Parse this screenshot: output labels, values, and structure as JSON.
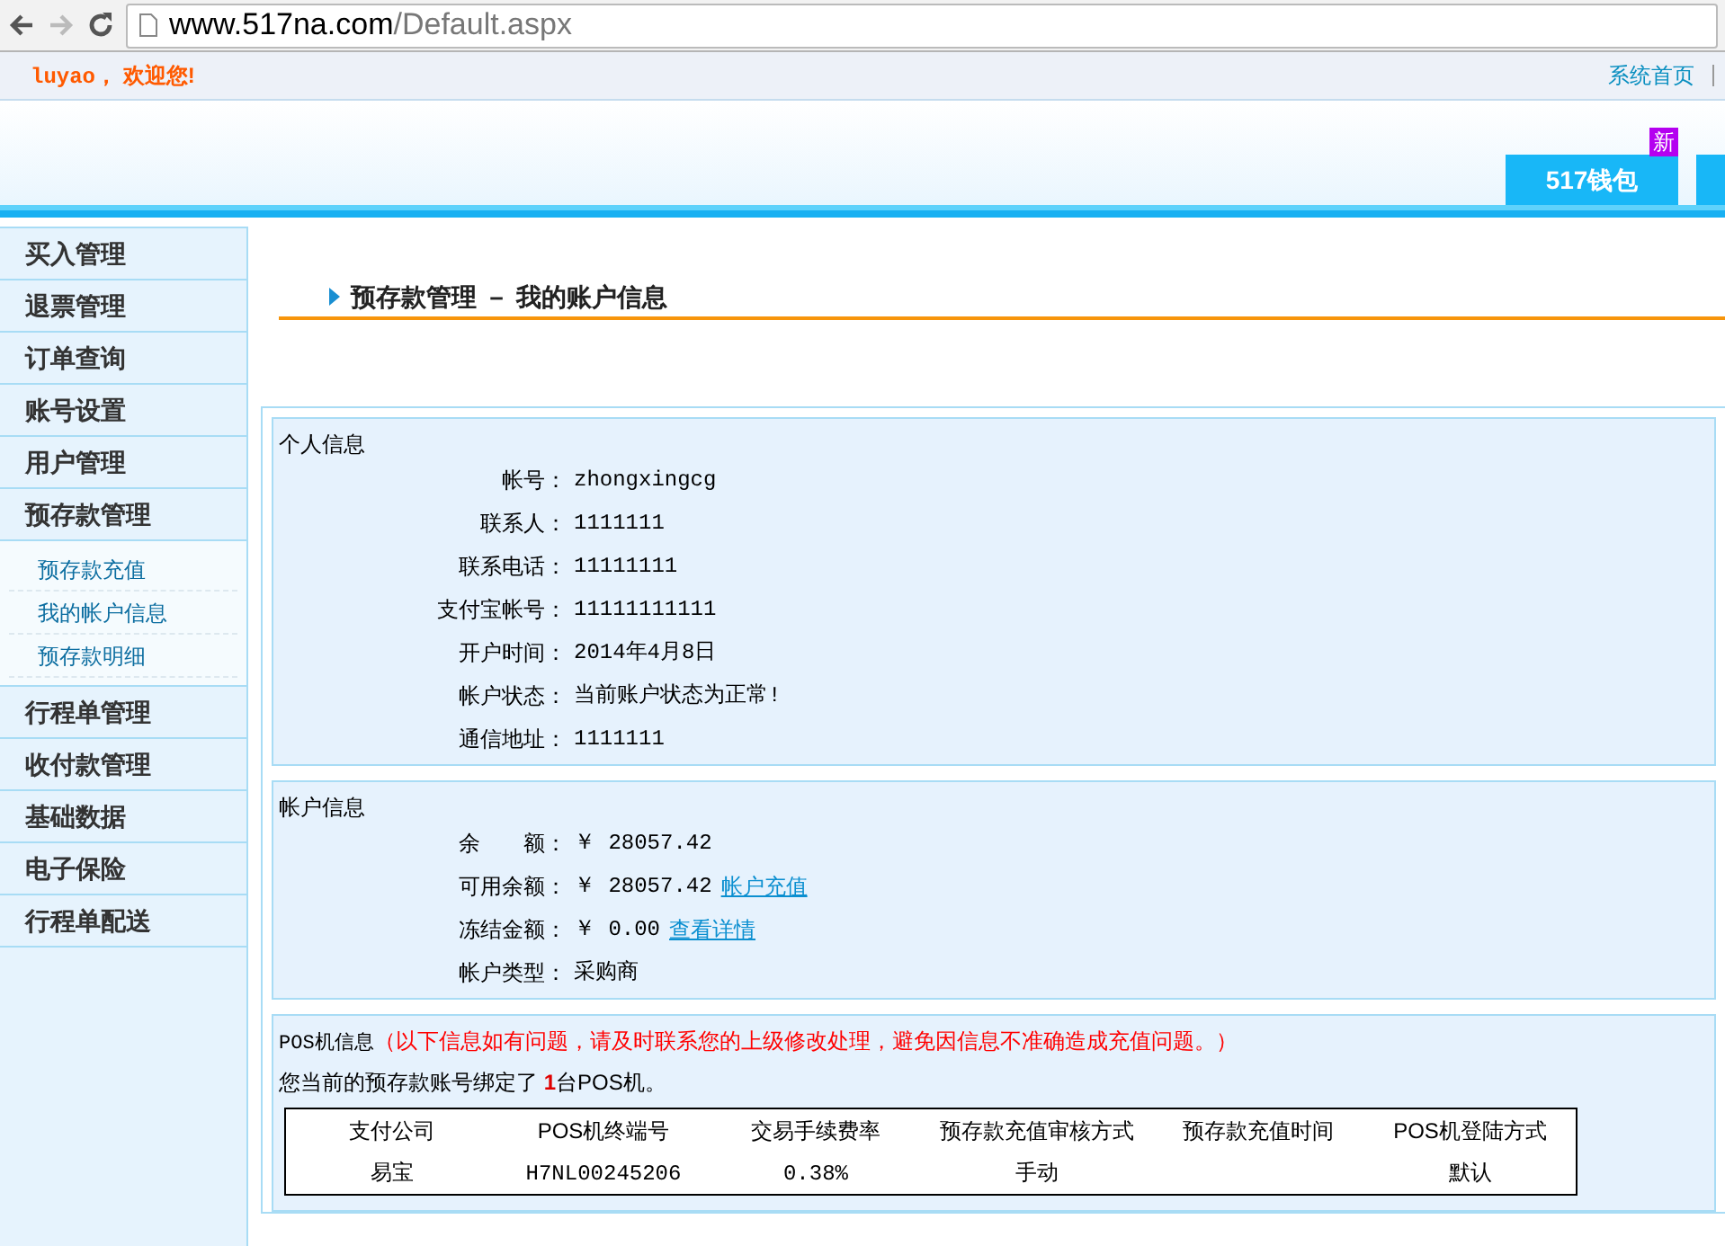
{
  "browser": {
    "url_host": "www.517na.com",
    "url_path": "/Default.aspx"
  },
  "top_bar": {
    "user": "luyao，",
    "greeting": "欢迎您!",
    "links": [
      "系统首页"
    ]
  },
  "header_tabs": [
    {
      "label": "517钱包",
      "badge": "新"
    }
  ],
  "sidebar": {
    "items": [
      {
        "label": "买入管理"
      },
      {
        "label": "退票管理"
      },
      {
        "label": "订单查询"
      },
      {
        "label": "账号设置"
      },
      {
        "label": "用户管理"
      },
      {
        "label": "预存款管理",
        "children": [
          {
            "label": "预存款充值"
          },
          {
            "label": "我的帐户信息"
          },
          {
            "label": "预存款明细"
          }
        ]
      },
      {
        "label": "行程单管理"
      },
      {
        "label": "收付款管理"
      },
      {
        "label": "基础数据"
      },
      {
        "label": "电子保险"
      },
      {
        "label": "行程单配送"
      }
    ]
  },
  "page_title": "预存款管理 － 我的账户信息",
  "personal_info": {
    "title": "个人信息",
    "fields": [
      {
        "label": "帐号：",
        "value": "zhongxingcg"
      },
      {
        "label": "联系人：",
        "value": "1111111"
      },
      {
        "label": "联系电话：",
        "value": "11111111"
      },
      {
        "label": "支付宝帐号：",
        "value": "11111111111"
      },
      {
        "label": "开户时间：",
        "value": "2014年4月8日"
      },
      {
        "label": "帐户状态：",
        "value": "当前账户状态为正常!"
      },
      {
        "label": "通信地址：",
        "value": "1111111"
      }
    ]
  },
  "account_info": {
    "title": "帐户信息",
    "fields": [
      {
        "label": "余　　额：",
        "value": "￥ 28057.42"
      },
      {
        "label": "可用余额：",
        "value": "￥ 28057.42",
        "link": "帐户充值"
      },
      {
        "label": "冻结金额：",
        "value": "￥ 0.00",
        "link": "查看详情"
      },
      {
        "label": "帐户类型：",
        "value": "采购商"
      }
    ]
  },
  "pos_info": {
    "title": "POS机信息",
    "notice": "（以下信息如有问题，请及时联系您的上级修改处理，避免因信息不准确造成充值问题。）",
    "binding": "您当前的预存款账号绑定了 **1**台POS机。",
    "table": {
      "columns": [
        "支付公司",
        "POS机终端号",
        "交易手续费率",
        "预存款充值审核方式",
        "预存款充值时间",
        "POS机登陆方式"
      ],
      "rows": [
        [
          "易宝",
          "H7NL00245206",
          "0.38%",
          "手动",
          "",
          "默认"
        ]
      ]
    }
  }
}
